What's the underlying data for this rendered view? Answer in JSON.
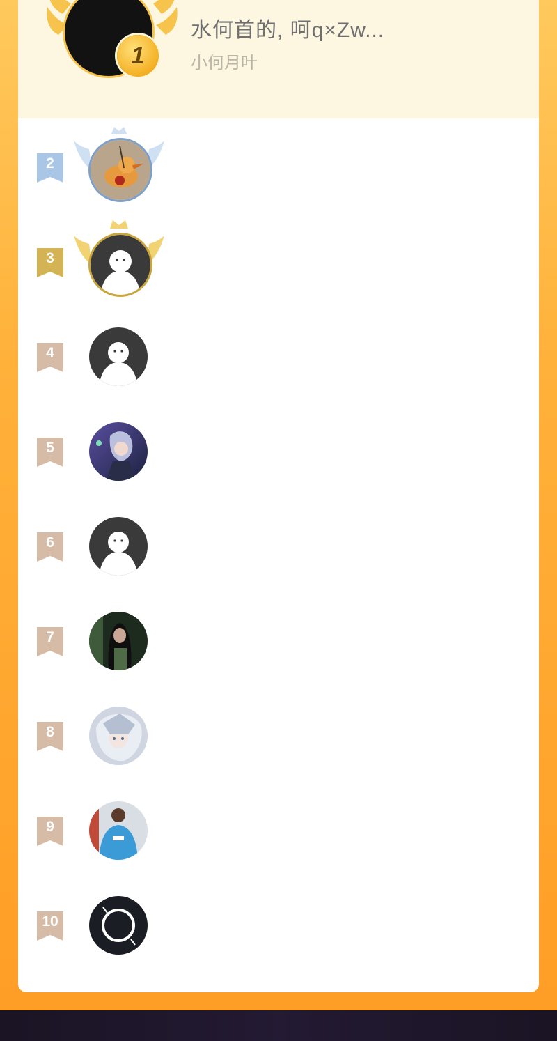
{
  "first_place": {
    "rank": "1",
    "name": "水何首的, 呵q×Zw...",
    "subtitle": "小何月叶"
  },
  "ranks": [
    {
      "rank": "2",
      "avatar": "duck-avatar",
      "frame": "silver"
    },
    {
      "rank": "3",
      "avatar": "default-avatar",
      "frame": "gold"
    },
    {
      "rank": "4",
      "avatar": "default-avatar",
      "frame": "none"
    },
    {
      "rank": "5",
      "avatar": "anime-avatar",
      "frame": "none"
    },
    {
      "rank": "6",
      "avatar": "default-avatar",
      "frame": "none"
    },
    {
      "rank": "7",
      "avatar": "portrait-avatar",
      "frame": "none"
    },
    {
      "rank": "8",
      "avatar": "anime-silver-avatar",
      "frame": "none"
    },
    {
      "rank": "9",
      "avatar": "person-avatar",
      "frame": "none"
    },
    {
      "rank": "10",
      "avatar": "ring-avatar",
      "frame": "none"
    }
  ],
  "colors": {
    "rank2": "#a9c6e6",
    "rank3": "#d4b355",
    "rank_other": "#d6bca6",
    "accent": "#ff9d25",
    "card": "#ffffff",
    "top_section": "#fdf6e0"
  }
}
